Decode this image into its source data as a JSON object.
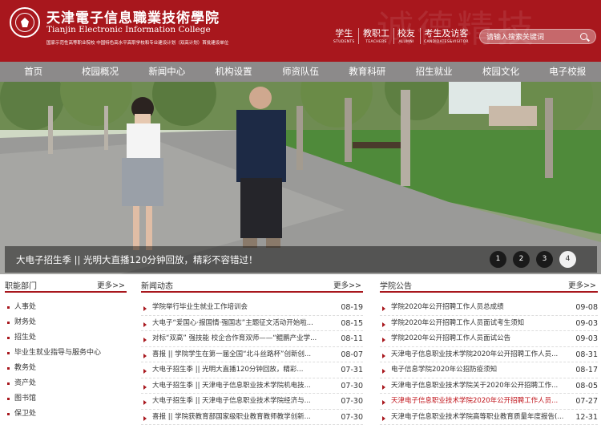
{
  "header": {
    "school_cn": "天津電子信息職業技術學院",
    "school_en": "Tianjin Electronic Information College",
    "school_sub": "国家示范性高等职业院校  中国特色高水平高职学校和专业建设计划（双高计划）首批建设单位",
    "quick_links": [
      {
        "cn": "学生",
        "en": "STUDENTS"
      },
      {
        "cn": "教职工",
        "en": "TEACHERS"
      },
      {
        "cn": "校友",
        "en": "ALUMNI"
      },
      {
        "cn": "考生及访客",
        "en": "CANDIDATES&VISITOR"
      }
    ],
    "search_placeholder": "请输入搜索关键词"
  },
  "nav": [
    "首页",
    "校园概况",
    "新闻中心",
    "机构设置",
    "师资队伍",
    "教育科研",
    "招生就业",
    "校园文化",
    "电子校报"
  ],
  "banner": {
    "caption": "大电子招生季 || 光明大直播120分钟回放，精彩不容错过！",
    "dots": [
      "1",
      "2",
      "3",
      "4"
    ],
    "active_dot": "4"
  },
  "columns": {
    "departments": {
      "title": "职能部门",
      "more": "更多>>",
      "items": [
        "人事处",
        "财务处",
        "招生处",
        "毕业生就业指导与服务中心",
        "教务处",
        "资产处",
        "图书馆",
        "保卫处"
      ]
    },
    "news": {
      "title": "新闻动态",
      "more": "更多>>",
      "items": [
        {
          "text": "学院举行毕业生就业工作培训会",
          "date": "08-19"
        },
        {
          "text": "大电子“爱国心·报国情·强国志”主题征文活动开始啦...",
          "date": "08-15"
        },
        {
          "text": "对标“双高” 强技能 校企合作育双师——“鲲鹏产业学...",
          "date": "08-11"
        },
        {
          "text": "喜报 || 学院学生在第一届全国“北斗丝路杯”创新创...",
          "date": "08-07"
        },
        {
          "text": "大电子招生季 || 光明大直播120分钟回放，精彩...",
          "date": "07-31"
        },
        {
          "text": "大电子招生季 || 天津电子信息职业技术学院机电技...",
          "date": "07-30"
        },
        {
          "text": "大电子招生季 || 天津电子信息职业技术学院经济与...",
          "date": "07-30"
        },
        {
          "text": "喜报 || 学院获教育部国家级职业教育教师教学创新...",
          "date": "07-30"
        }
      ]
    },
    "notices": {
      "title": "学院公告",
      "more": "更多>>",
      "items": [
        {
          "text": "学院2020年公开招聘工作人员总成绩",
          "date": "09-08",
          "hl": false
        },
        {
          "text": "学院2020年公开招聘工作人员面试考生须知",
          "date": "09-03",
          "hl": false
        },
        {
          "text": "学院2020年公开招聘工作人员面试公告",
          "date": "09-03",
          "hl": false
        },
        {
          "text": "天津电子信息职业技术学院2020年公开招聘工作人员...",
          "date": "08-31",
          "hl": false
        },
        {
          "text": "电子信息学院2020年公招防疫须知",
          "date": "08-17",
          "hl": false
        },
        {
          "text": "天津电子信息职业技术学院关于2020年公开招聘工作...",
          "date": "08-05",
          "hl": false
        },
        {
          "text": "天津电子信息职业技术学院2020年公开招聘工作人员...",
          "date": "07-27",
          "hl": true
        },
        {
          "text": "天津电子信息职业技术学院高等职业教育质量年度报告(...",
          "date": "12-31",
          "hl": false
        }
      ]
    }
  },
  "colors": {
    "brand_red": "#a8171d",
    "nav_gray": "#8c8a8a",
    "highlight_red": "#c0141b"
  }
}
